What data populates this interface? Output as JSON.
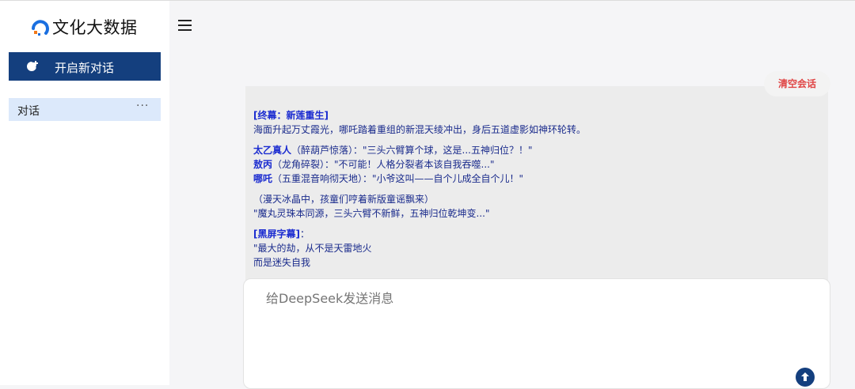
{
  "sidebar": {
    "logo_text": "文化大数据",
    "new_chat_label": "开启新对话",
    "conversations": [
      {
        "label": "对话",
        "more": "···"
      }
    ]
  },
  "toolbar": {
    "clear_label": "清空会话"
  },
  "message": {
    "s1_title": "[终幕：新莲重生]",
    "s1_text": "海面升起万丈霞光，哪吒踏着重组的新混天绫冲出，身后五道虚影如神环轮转。",
    "l1_name": "太乙真人",
    "l1_text": "（醉葫芦惊落）：\"三头六臂算个球，这是...五神归位？！\"",
    "l2_name": "敖丙",
    "l2_text": "（龙角碎裂）：\"不可能！人格分裂者本该自我吞噬...\"",
    "l3_name": "哪吒",
    "l3_text": "（五重混音响彻天地）：\"小爷这叫——自个儿成全自个儿！\"",
    "s3_line1": "（漫天冰晶中，孩童们哼着新版童谣飘来）",
    "s3_line2": "\"魔丸灵珠本同源，三头六臂不新鲜，五神归位乾坤变...\"",
    "s4_title": "[黑屏字幕]",
    "s4_colon": "：",
    "s4_line1": "\"最大的劫，从不是天雷地火",
    "s4_line2": "而是迷失自我"
  },
  "input": {
    "placeholder": "给DeepSeek发送消息"
  },
  "colors": {
    "brand": "#143f7e",
    "selected": "#dce9fb",
    "clear_text": "#e04545"
  }
}
